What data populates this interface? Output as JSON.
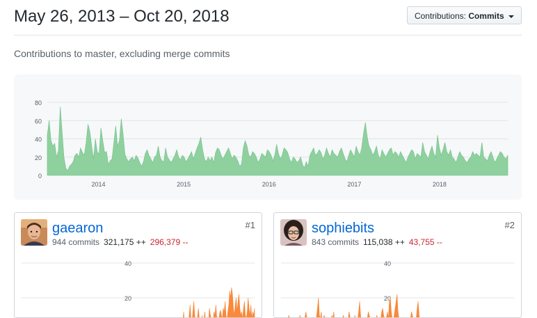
{
  "header": {
    "title": "May 26, 2013 – Oct 20, 2018",
    "dropdown_prefix": "Contributions: ",
    "dropdown_value": "Commits"
  },
  "subtitle": "Contributions to master, excluding merge commits",
  "colors": {
    "main_area": "#8fd19e",
    "main_line": "#6fbf85",
    "user_area": "#f9893b",
    "grid": "#e1e4e8",
    "tick_text": "#586069"
  },
  "chart_data": [
    {
      "type": "area",
      "ylim": [
        0,
        80
      ],
      "y_ticks": [
        "0",
        "20",
        "40",
        "60",
        "80"
      ],
      "x_ticks": [
        "2014",
        "2015",
        "2016",
        "2017",
        "2018"
      ],
      "x_range": [
        2013.4,
        2018.8
      ],
      "x_tick_values": [
        2014,
        2015,
        2016,
        2017,
        2018
      ],
      "values": [
        44,
        60,
        38,
        32,
        35,
        20,
        27,
        75,
        48,
        20,
        8,
        5,
        10,
        12,
        15,
        22,
        24,
        20,
        30,
        25,
        22,
        36,
        56,
        48,
        32,
        18,
        40,
        26,
        23,
        52,
        38,
        25,
        26,
        12,
        16,
        18,
        36,
        54,
        32,
        38,
        62,
        45,
        23,
        18,
        15,
        18,
        20,
        16,
        22,
        19,
        14,
        10,
        15,
        24,
        28,
        22,
        18,
        14,
        20,
        22,
        32,
        20,
        16,
        15,
        30,
        20,
        17,
        14,
        18,
        22,
        28,
        20,
        17,
        22,
        20,
        15,
        18,
        22,
        26,
        18,
        24,
        30,
        35,
        42,
        28,
        18,
        15,
        20,
        16,
        20,
        14,
        25,
        30,
        28,
        22,
        18,
        22,
        26,
        30,
        24,
        18,
        22,
        20,
        16,
        10,
        12,
        30,
        38,
        32,
        22,
        20,
        26,
        24,
        20,
        14,
        18,
        24,
        22,
        20,
        28,
        26,
        22,
        16,
        22,
        34,
        24,
        18,
        22,
        30,
        28,
        25,
        18,
        14,
        20,
        18,
        14,
        16,
        20,
        12,
        8,
        15,
        10,
        22,
        26,
        30,
        22,
        24,
        28,
        25,
        18,
        22,
        30,
        24,
        20,
        28,
        24,
        22,
        20,
        26,
        30,
        24,
        18,
        15,
        22,
        28,
        24,
        20,
        32,
        26,
        22,
        30,
        46,
        58,
        42,
        32,
        28,
        22,
        26,
        32,
        22,
        18,
        28,
        24,
        20,
        24,
        28,
        30,
        22,
        26,
        24,
        20,
        26,
        22,
        18,
        14,
        20,
        24,
        28,
        26,
        18,
        24,
        22,
        20,
        36,
        26,
        22,
        18,
        26,
        32,
        24,
        20,
        44,
        30,
        22,
        28,
        36,
        26,
        22,
        28,
        20,
        18,
        14,
        20,
        26,
        22,
        20,
        16,
        14,
        18,
        20,
        26,
        22,
        24,
        22,
        20,
        36,
        20,
        18,
        16,
        22,
        26,
        20,
        14,
        18,
        22,
        26,
        24,
        20,
        18,
        22
      ]
    },
    {
      "type": "area",
      "user": "gaearon",
      "ylim": [
        0,
        40
      ],
      "y_ticks": [
        "20",
        "40"
      ],
      "x_range": [
        2013.4,
        2018.8
      ],
      "values": [
        0,
        0,
        0,
        0,
        0,
        0,
        0,
        0,
        0,
        0,
        0,
        0,
        0,
        0,
        0,
        0,
        0,
        0,
        0,
        0,
        0,
        0,
        0,
        0,
        0,
        0,
        0,
        0,
        0,
        0,
        0,
        0,
        0,
        0,
        0,
        0,
        0,
        0,
        0,
        0,
        0,
        0,
        0,
        0,
        0,
        0,
        0,
        0,
        0,
        0,
        0,
        0,
        0,
        0,
        0,
        0,
        0,
        0,
        0,
        0,
        0,
        0,
        0,
        0,
        0,
        0,
        0,
        0,
        0,
        0,
        0,
        0,
        0,
        0,
        0,
        0,
        0,
        0,
        0,
        0,
        0,
        0,
        0,
        0,
        0,
        0,
        0,
        0,
        0,
        0,
        0,
        0,
        0,
        0,
        0,
        0,
        0,
        0,
        0,
        0,
        0,
        0,
        0,
        0,
        0,
        0,
        0,
        0,
        0,
        0,
        0,
        0,
        0,
        0,
        0,
        0,
        0,
        0,
        0,
        0,
        0,
        0,
        0,
        0,
        0,
        0,
        0,
        0,
        0,
        0,
        0,
        0,
        0,
        0,
        0,
        0,
        0,
        0,
        0,
        0,
        0,
        0,
        0,
        0,
        0,
        0,
        0,
        0,
        0,
        0,
        0,
        0,
        0,
        0,
        0,
        0,
        0,
        0,
        0,
        0,
        0,
        0,
        0,
        0,
        0,
        0,
        0,
        4,
        2,
        6,
        3,
        8,
        5,
        2,
        4,
        6,
        12,
        5,
        3,
        8,
        6,
        4,
        10,
        16,
        8,
        6,
        12,
        18,
        10,
        7,
        5,
        9,
        14,
        8,
        6,
        4,
        10,
        6,
        8,
        12,
        5,
        7,
        9,
        6,
        14,
        10,
        8,
        5,
        7,
        12,
        10,
        16,
        8,
        9,
        6,
        11,
        13,
        10,
        8,
        14,
        12,
        18,
        10,
        7,
        12,
        16,
        24,
        20,
        26,
        22,
        14,
        10,
        16,
        20,
        12,
        18,
        22,
        14,
        10,
        12,
        8,
        14,
        18,
        10,
        8,
        12,
        20,
        14,
        10,
        16,
        8,
        12,
        10,
        14
      ]
    },
    {
      "type": "area",
      "user": "sophiebits",
      "ylim": [
        0,
        40
      ],
      "y_ticks": [
        "20",
        "40"
      ],
      "x_range": [
        2013.4,
        2018.8
      ],
      "values": [
        2,
        4,
        3,
        6,
        8,
        5,
        4,
        6,
        10,
        8,
        5,
        3,
        6,
        8,
        4,
        5,
        7,
        6,
        4,
        8,
        10,
        6,
        5,
        4,
        6,
        9,
        12,
        8,
        6,
        4,
        5,
        8,
        6,
        4,
        3,
        5,
        7,
        9,
        14,
        20,
        10,
        8,
        12,
        6,
        8,
        10,
        7,
        9,
        5,
        6,
        8,
        4,
        6,
        10,
        8,
        12,
        6,
        4,
        8,
        5,
        3,
        6,
        4,
        5,
        8,
        10,
        7,
        4,
        6,
        5,
        8,
        12,
        9,
        6,
        4,
        8,
        6,
        10,
        7,
        5,
        8,
        12,
        18,
        10,
        6,
        5,
        8,
        7,
        4,
        6,
        8,
        12,
        10,
        8,
        6,
        5,
        7,
        4,
        6,
        8,
        10,
        6,
        4,
        5,
        8,
        12,
        14,
        10,
        8,
        6,
        9,
        12,
        8,
        18,
        20,
        12,
        8,
        6,
        10,
        14,
        18,
        22,
        12,
        8,
        6,
        4,
        5,
        8,
        6,
        4,
        3,
        5,
        6,
        4,
        5,
        8,
        12,
        10,
        6,
        4,
        5,
        8,
        14,
        18,
        10,
        6,
        4,
        5,
        8,
        6,
        4,
        2,
        3,
        4,
        6,
        5,
        4,
        3,
        2,
        4,
        5,
        3,
        4,
        6,
        4,
        3,
        5,
        4,
        3,
        2,
        4,
        6,
        5,
        3,
        4,
        2,
        3,
        4,
        5,
        6,
        4,
        3,
        2,
        4,
        3,
        2,
        4,
        5,
        3,
        2,
        4,
        3,
        2,
        3,
        4,
        2,
        3,
        4,
        5,
        3,
        2,
        4,
        3,
        2,
        3,
        4,
        2,
        3,
        2,
        4,
        3,
        2,
        3,
        4,
        2,
        3,
        2,
        3,
        4,
        3,
        2,
        3,
        4,
        2,
        3,
        2,
        3,
        2,
        4,
        3,
        2,
        3,
        4,
        2,
        3,
        2,
        3,
        2,
        4,
        3,
        2,
        3,
        2,
        3
      ]
    }
  ],
  "contributors": [
    {
      "username": "gaearon",
      "rank": "#1",
      "commits": "944 commits",
      "additions": "321,175 ++",
      "deletions": "296,379 --"
    },
    {
      "username": "sophiebits",
      "rank": "#2",
      "commits": "843 commits",
      "additions": "115,038 ++",
      "deletions": "43,755 --"
    }
  ]
}
